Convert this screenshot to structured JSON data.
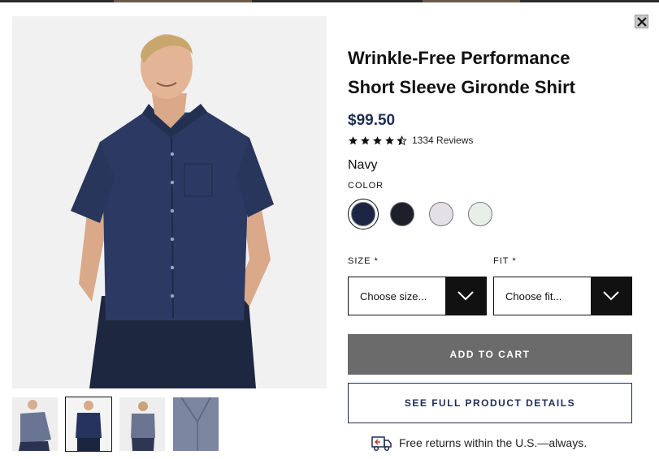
{
  "product": {
    "title_line1": "Wrinkle-Free Performance",
    "title_line2": "Short Sleeve Gironde Shirt",
    "price": "$99.50",
    "rating": 4.5,
    "reviews": "1334 Reviews"
  },
  "color": {
    "selected_name": "Navy",
    "label": "COLOR",
    "swatches": [
      {
        "name": "navy",
        "hex": "#1c2644",
        "selected": true
      },
      {
        "name": "black",
        "hex": "#1f1f2b",
        "selected": false
      },
      {
        "name": "light-gray",
        "hex": "#e3e1e5",
        "selected": false
      },
      {
        "name": "mint",
        "hex": "#e8efe9",
        "selected": false
      }
    ]
  },
  "size": {
    "label": "SIZE *",
    "placeholder": "Choose size..."
  },
  "fit": {
    "label": "FIT *",
    "placeholder": "Choose fit..."
  },
  "buttons": {
    "add_to_cart": "ADD TO CART",
    "see_details": "SEE FULL PRODUCT DETAILS"
  },
  "returns": {
    "text": "Free returns within the U.S.—always.",
    "icon": "return-truck-icon"
  },
  "icons": {
    "close": "close-icon",
    "dropdown": "chevron-down-icon",
    "star": "star-icon"
  },
  "gallery": {
    "thumbnail_count": 4,
    "selected_thumbnail": 1
  },
  "colors": {
    "navy_text": "#1f2d55",
    "add_to_cart_bg": "#6b6b6b",
    "shirt": "#2c3a63"
  }
}
